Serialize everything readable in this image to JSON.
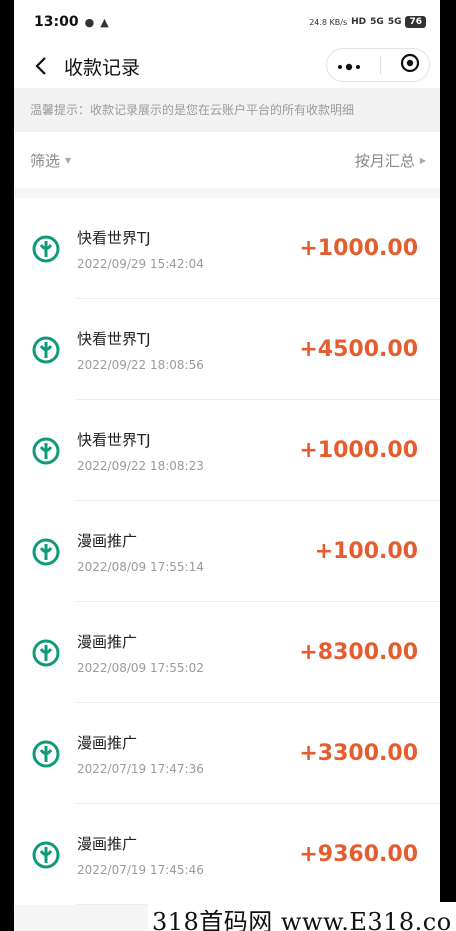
{
  "status_bar": {
    "time": "13:00",
    "net_speed": "24.8 KB/s",
    "hd_label": "HD",
    "signal1": "5G",
    "signal2": "5G",
    "battery": "76"
  },
  "nav": {
    "title": "收款记录",
    "back_icon": "chevron-left-icon",
    "more_icon": "more-dots-icon",
    "close_icon": "target-circle-icon"
  },
  "tip": {
    "text": "温馨提示：收款记录展示的是您在云账户平台的所有收款明细"
  },
  "filter": {
    "left_label": "筛选",
    "right_label": "按月汇总"
  },
  "colors": {
    "amount": "#e45d2f",
    "bank_icon": "#0f9b7a"
  },
  "records": [
    {
      "name": "快看世界TJ",
      "time": "2022/09/29 15:42:04",
      "amount": "+1000.00"
    },
    {
      "name": "快看世界TJ",
      "time": "2022/09/22 18:08:56",
      "amount": "+4500.00"
    },
    {
      "name": "快看世界TJ",
      "time": "2022/09/22 18:08:23",
      "amount": "+1000.00"
    },
    {
      "name": "漫画推广",
      "time": "2022/08/09 17:55:14",
      "amount": "+100.00"
    },
    {
      "name": "漫画推广",
      "time": "2022/08/09 17:55:02",
      "amount": "+8300.00"
    },
    {
      "name": "漫画推广",
      "time": "2022/07/19 17:47:36",
      "amount": "+3300.00"
    },
    {
      "name": "漫画推广",
      "time": "2022/07/19 17:45:46",
      "amount": "+9360.00"
    }
  ],
  "watermark": "318首码网 www.E318.co"
}
